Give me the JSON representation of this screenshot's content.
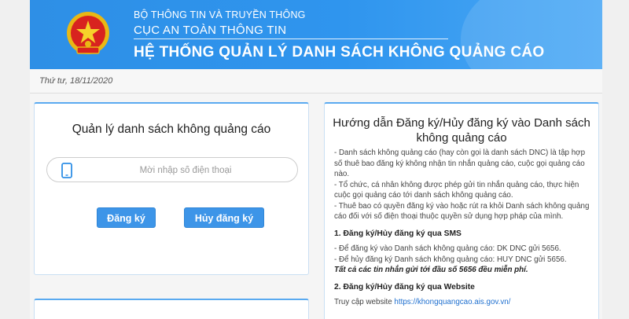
{
  "header": {
    "ministry": "BỘ THÔNG TIN VÀ TRUYỀN THÔNG",
    "department": "CỤC AN TOÀN THÔNG TIN",
    "system_title": "HỆ THỐNG QUẢN LÝ DANH SÁCH KHÔNG QUẢNG CÁO",
    "emblem_icon": "national-emblem-icon"
  },
  "date": "Thứ tư, 18/11/2020",
  "manage": {
    "title": "Quản lý danh sách không quảng cáo",
    "phone_placeholder": "Mời nhập số điện thoại",
    "phone_value": "",
    "register_label": "Đăng ký",
    "unregister_label": "Hủy đăng ký"
  },
  "guide": {
    "title": "Hướng dẫn Đăng ký/Hủy đăng ký vào Danh sách không quảng cáo",
    "intro": [
      "- Danh sách không quảng cáo (hay còn gọi là danh sách DNC) là tập hợp số thuê bao đăng ký không nhận tin nhắn quảng cáo, cuộc gọi quảng cáo nào.",
      "- Tổ chức, cá nhân không được phép gửi tin nhắn quảng cáo, thực hiện cuộc gọi quảng cáo tới danh sách không quảng cáo.",
      "- Thuê bao có quyền đăng ký vào hoặc rút ra khỏi Danh sách không quảng cáo đối với số điện thoại thuộc quyền sử dụng hợp pháp của mình."
    ],
    "sms_heading": "1. Đăng ký/Hủy đăng ký qua SMS",
    "sms_lines": [
      "- Để đăng ký vào Danh sách không quảng cáo: DK DNC gửi 5656.",
      "- Để hủy đăng ký Danh sách không quảng cáo: HUY DNC gửi 5656."
    ],
    "sms_free_note": "Tất cả các tin nhắn gửi tới đầu số 5656 đều miễn phí.",
    "web_heading": "2. Đăng ký/Hủy đăng ký qua Website",
    "web_prefix": "Truy cập website ",
    "web_link": "https://khongquangcao.ais.gov.vn/"
  },
  "colors": {
    "header_blue": "#2f95ee",
    "button_blue": "#3d95e8",
    "emblem_red": "#d8231f",
    "emblem_gold": "#f2c31a"
  }
}
